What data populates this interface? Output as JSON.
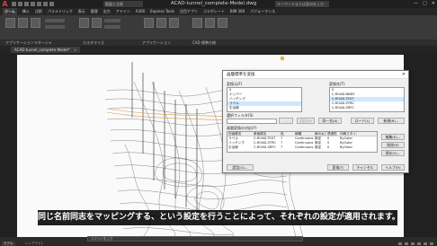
{
  "titlebar": {
    "app_logo": "A",
    "workspace": "製図と注釈",
    "title": "ACAD-tunnel_complete-Model.dwg",
    "search_placeholder": "キーワードまたは語句を入力",
    "user": "",
    "window_buttons": [
      "—",
      "□",
      "✕"
    ]
  },
  "ribbon": {
    "tabs": [
      "ホーム",
      "挿入",
      "注釈",
      "パラメトリック",
      "表示",
      "管理",
      "出力",
      "アドイン",
      "A360",
      "Express Tools",
      "注目アプリ",
      "コラボレート",
      "BIM 360",
      "パフォーマンス"
    ],
    "active_tab": "ホーム",
    "panel_titles": [
      "アプリケーションマネージャ",
      "カスタマイズ",
      "アプリケーション",
      "CAD 標準仕様"
    ]
  },
  "document": {
    "tab_label": "ACAD-tunnel_complete-Model*",
    "close_glyph": "×"
  },
  "dialog": {
    "title": "画層標準を変換",
    "close_glyph": "✕",
    "from_label": "変換元(F)",
    "from_items": [
      "0",
      "ナンバー",
      "ハッチング",
      "ラベル",
      "引出線"
    ],
    "to_label": "変換先(T)",
    "to_items": [
      "0",
      "C-ROAD-BNDY",
      "C-ROAD-TEXT",
      "C-ROAD-STRC",
      "C-ROAD-SRFC",
      "C-ROAD-PRFL"
    ],
    "selection_filter_label": "選択フィルタ(S)",
    "map_button": "対応(M)",
    "map_same_button": "同一名(A)",
    "load_button": "ロード(L)",
    "new_button": "新規(N)...",
    "list_label": "画層変換の対応(Y)",
    "table_headers": [
      "旧画層名",
      "新画層名",
      "色",
      "線種",
      "線の太さ",
      "透過性",
      "印刷スタイル"
    ],
    "table_rows": [
      [
        "ラベル",
        "C-ROAD-TEXT",
        "7",
        "Continuous",
        "既定",
        "0",
        "ByColor"
      ],
      [
        "ハッチング",
        "C-ROAD-STRC",
        "7",
        "Continuous",
        "既定",
        "0",
        "ByColor"
      ],
      [
        "引出線",
        "C-ROAD-SRFC",
        "7",
        "Continuous",
        "既定",
        "0",
        "ByColor"
      ]
    ],
    "edit_button": "編集(E)...",
    "remove_button": "削除(R)",
    "save_button": "保存(V)...",
    "settings_button": "設定(G)...",
    "translate_button": "変換(T)",
    "cancel_button": "キャンセル",
    "help_button": "ヘルプ(H)"
  },
  "subtitle": "同じ名前同志をマッピングする、という設定を行うことによって、それぞれの設定が適用されます。",
  "command_line": {
    "placeholder": "コマンドを入力"
  },
  "statusbar": {
    "layout_tabs": [
      "モデル",
      "レイアウト1"
    ]
  }
}
